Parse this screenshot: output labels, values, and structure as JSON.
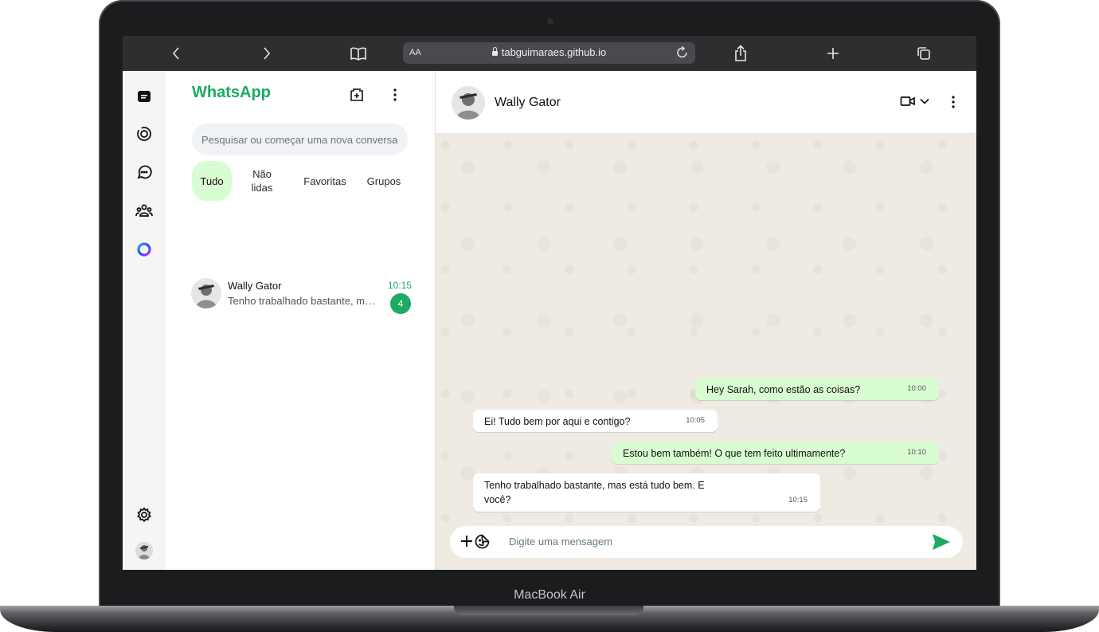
{
  "device": {
    "brand_label": "MacBook Air"
  },
  "browser": {
    "url": "tabguimaraes.github.io",
    "text_size_label": "AA",
    "icons": [
      "back-icon",
      "forward-icon",
      "bookmarks-icon",
      "lock-icon",
      "reload-icon",
      "share-icon",
      "new-tab-icon",
      "tabs-icon"
    ]
  },
  "app": {
    "title": "WhatsApp",
    "accent_color": "#1daa61",
    "bubble_out_color": "#d9fdd3",
    "search_placeholder": "Pesquisar ou começar uma nova conversa",
    "filters": [
      {
        "label": "Tudo",
        "active": true
      },
      {
        "label": "Não\nlidas",
        "active": false
      },
      {
        "label": "Favoritas",
        "active": false
      },
      {
        "label": "Grupos",
        "active": false
      }
    ],
    "rail_icons": [
      "chats-icon",
      "status-icon",
      "channels-icon",
      "communities-icon",
      "meta-ai-icon",
      "settings-icon",
      "profile-avatar"
    ],
    "chats": [
      {
        "name": "Wally Gator",
        "time": "10:15",
        "preview": "Tenho trabalhado bastante, mas está tudo bem. E você?",
        "unread": "4"
      }
    ]
  },
  "conversation": {
    "contact_name": "Wally Gator",
    "messages": [
      {
        "direction": "out",
        "text": "Hey Sarah, como estão as coisas?",
        "time": "10:00"
      },
      {
        "direction": "in",
        "text": "Ei! Tudo bem por aqui e contigo?",
        "time": "10:05"
      },
      {
        "direction": "out",
        "text": "Estou bem também! O que tem feito ultimamente?",
        "time": "10:10"
      },
      {
        "direction": "in",
        "text": "Tenho trabalhado bastante, mas está tudo bem. E você?",
        "time": "10:15"
      }
    ],
    "composer_placeholder": "Digite uma mensagem"
  }
}
